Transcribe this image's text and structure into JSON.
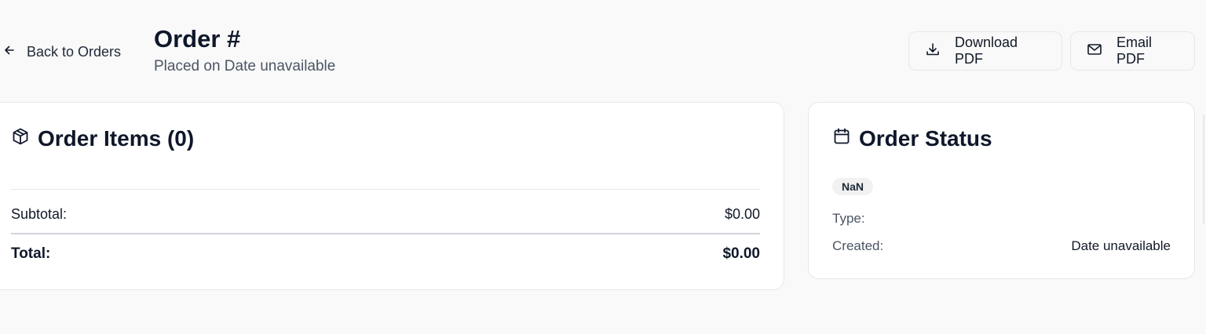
{
  "header": {
    "back_label": "Back to Orders",
    "title": "Order #",
    "subtitle": "Placed on Date unavailable",
    "download_label": "Download PDF",
    "email_label": "Email PDF"
  },
  "items_card": {
    "title": "Order Items (0)",
    "subtotal_label": "Subtotal:",
    "subtotal_value": "$0.00",
    "total_label": "Total:",
    "total_value": "$0.00"
  },
  "status_card": {
    "title": "Order Status",
    "badge": "NaN",
    "type_label": "Type:",
    "type_value": "",
    "created_label": "Created:",
    "created_value": "Date unavailable"
  },
  "icons": {
    "back": "arrow-left-icon",
    "download": "download-icon",
    "email": "mail-icon",
    "items": "package-icon",
    "status": "calendar-icon"
  }
}
